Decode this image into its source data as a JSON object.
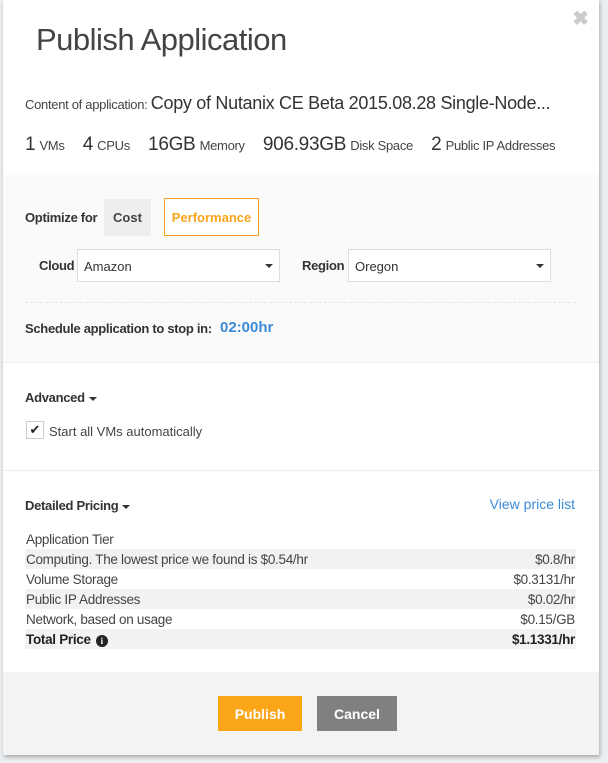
{
  "title": "Publish Application",
  "content_label": "Content of application:",
  "content_value": "Copy of Nutanix CE Beta 2015.08.28 Single-Node...",
  "stats": [
    {
      "n": "1",
      "u": "VMs"
    },
    {
      "n": "4",
      "u": "CPUs"
    },
    {
      "n": "16GB",
      "u": "Memory"
    },
    {
      "n": "906.93GB",
      "u": "Disk Space"
    },
    {
      "n": "2",
      "u": "Public IP Addresses"
    }
  ],
  "optimize": {
    "label": "Optimize for",
    "cost": "Cost",
    "performance": "Performance",
    "selected": "Performance",
    "accent": "#f7a31c"
  },
  "cloud": {
    "label": "Cloud",
    "value": "Amazon"
  },
  "region": {
    "label": "Region",
    "value": "Oregon"
  },
  "schedule": {
    "label": "Schedule application to stop in:",
    "value": "02:00hr"
  },
  "advanced": {
    "label": "Advanced",
    "start_all_label": "Start all VMs automatically",
    "start_all_checked": true
  },
  "pricing": {
    "label": "Detailed Pricing",
    "view_link": "View price list",
    "rows": [
      {
        "name": "Application Tier",
        "price": ""
      },
      {
        "name": "Computing. The lowest price we found is $0.54/hr",
        "price": "$0.8/hr"
      },
      {
        "name": "Volume Storage",
        "price": "$0.3131/hr"
      },
      {
        "name": "Public IP Addresses",
        "price": "$0.02/hr"
      },
      {
        "name": "Network, based on usage",
        "price": "$0.15/GB"
      }
    ],
    "total_label": "Total Price",
    "total_value": "$1.1331/hr"
  },
  "buttons": {
    "publish": "Publish",
    "cancel": "Cancel"
  }
}
